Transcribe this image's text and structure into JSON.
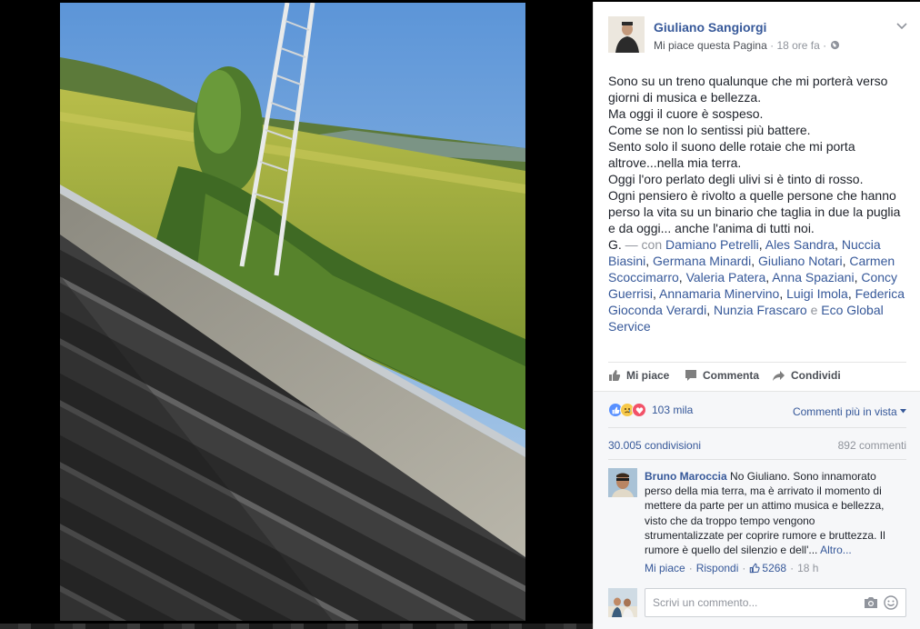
{
  "photo": {
    "alt": ""
  },
  "post": {
    "author": "Giuliano Sangiorgi",
    "like_page": "Mi piace questa Pagina",
    "time": "18 ore fa",
    "text_lines": [
      "Sono su un treno qualunque che mi porterà verso",
      "giorni di musica e bellezza.",
      "Ma oggi il cuore è sospeso.",
      "Come se non lo sentissi più battere.",
      "Sento solo il suono delle rotaie che mi porta",
      "altrove...nella mia terra.",
      "Oggi l'oro perlato degli ulivi si è tinto di rosso.",
      "Ogni pensiero è rivolto a quelle persone che hanno",
      "perso la vita su un binario che taglia in due la puglia",
      "e da oggi... anche l'anima di tutti noi."
    ],
    "signature": "G.",
    "with_label": "— con",
    "tagged": [
      "Damiano Petrelli",
      "Ales Sandra",
      "Nuccia Biasini",
      "Germana Minardi",
      "Giuliano Notari",
      "Carmen Scoccimarro",
      "Valeria Patera",
      "Anna Spaziani",
      "Concy Guerrisi",
      "Annamaria Minervino",
      "Luigi Imola",
      "Federica Gioconda Verardi",
      "Nunzia Frascaro"
    ],
    "and_word": "e",
    "last_tagged": "Eco Global Service"
  },
  "actions": {
    "like": "Mi piace",
    "comment": "Commenta",
    "share": "Condividi"
  },
  "stats": {
    "reactions": "103 mila",
    "sort": "Commenti più in vista",
    "shares": "30.005 condivisioni",
    "comments": "892 commenti"
  },
  "comment": {
    "author": "Bruno Maroccia",
    "line1": "No Giuliano. Sono innamorato",
    "lines": [
      "perso della mia terra, ma è arrivato il momento di",
      "mettere da parte per un attimo musica e bellezza,",
      "visto che da troppo tempo vengono",
      "strumentalizzate per coprire rumore e bruttezza. Il"
    ],
    "last_line": "rumore è quello del silenzio e dell'...",
    "more": "Altro...",
    "like": "Mi piace",
    "reply": "Rispondi",
    "likes": "5268",
    "time": "18 h"
  },
  "composer": {
    "placeholder": "Scrivi un commento..."
  },
  "colors": {
    "link": "#365899",
    "text": "#1d2129",
    "muted": "#90949c",
    "like_blue": "#5890ff",
    "love_red": "#f25268",
    "sad_yellow": "#f7c94a"
  },
  "icons": [
    "chevron-down-icon",
    "globe-icon",
    "thumbs-up-icon",
    "comment-icon",
    "share-icon",
    "like-reaction-icon",
    "sad-reaction-icon",
    "love-reaction-icon",
    "camera-icon",
    "emoji-icon"
  ]
}
